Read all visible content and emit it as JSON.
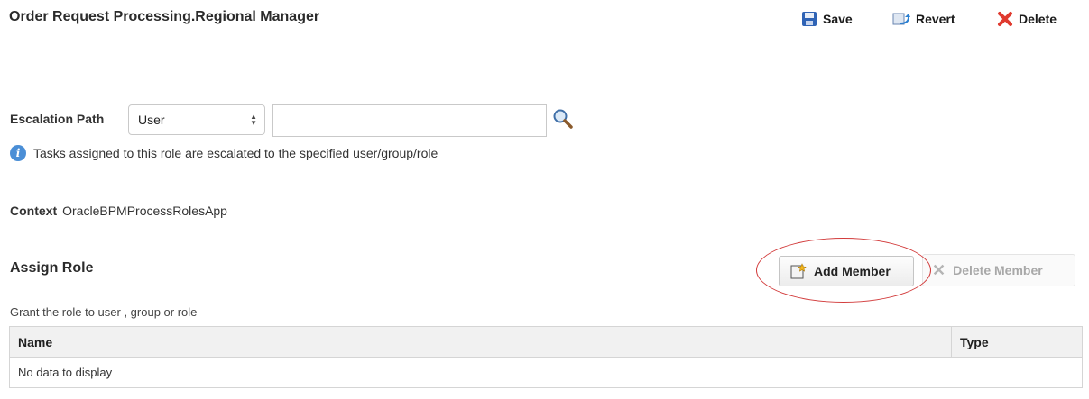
{
  "header": {
    "title": "Order Request Processing.Regional Manager",
    "save_label": "Save",
    "revert_label": "Revert",
    "delete_label": "Delete"
  },
  "escalation": {
    "label": "Escalation Path",
    "selected": "User",
    "value": "",
    "info": "Tasks assigned to this role are escalated to the specified user/group/role"
  },
  "context": {
    "label": "Context",
    "value": "OracleBPMProcessRolesApp"
  },
  "assign": {
    "title": "Assign Role",
    "add_label": "Add Member",
    "delete_label": "Delete Member",
    "description": "Grant the role to user , group or role",
    "columns": [
      "Name",
      "Type"
    ],
    "empty_text": "No data to display"
  },
  "colors": {
    "highlight": "#d23a3a",
    "info": "#4a8ed6",
    "delete_icon": "#e03a2f"
  }
}
